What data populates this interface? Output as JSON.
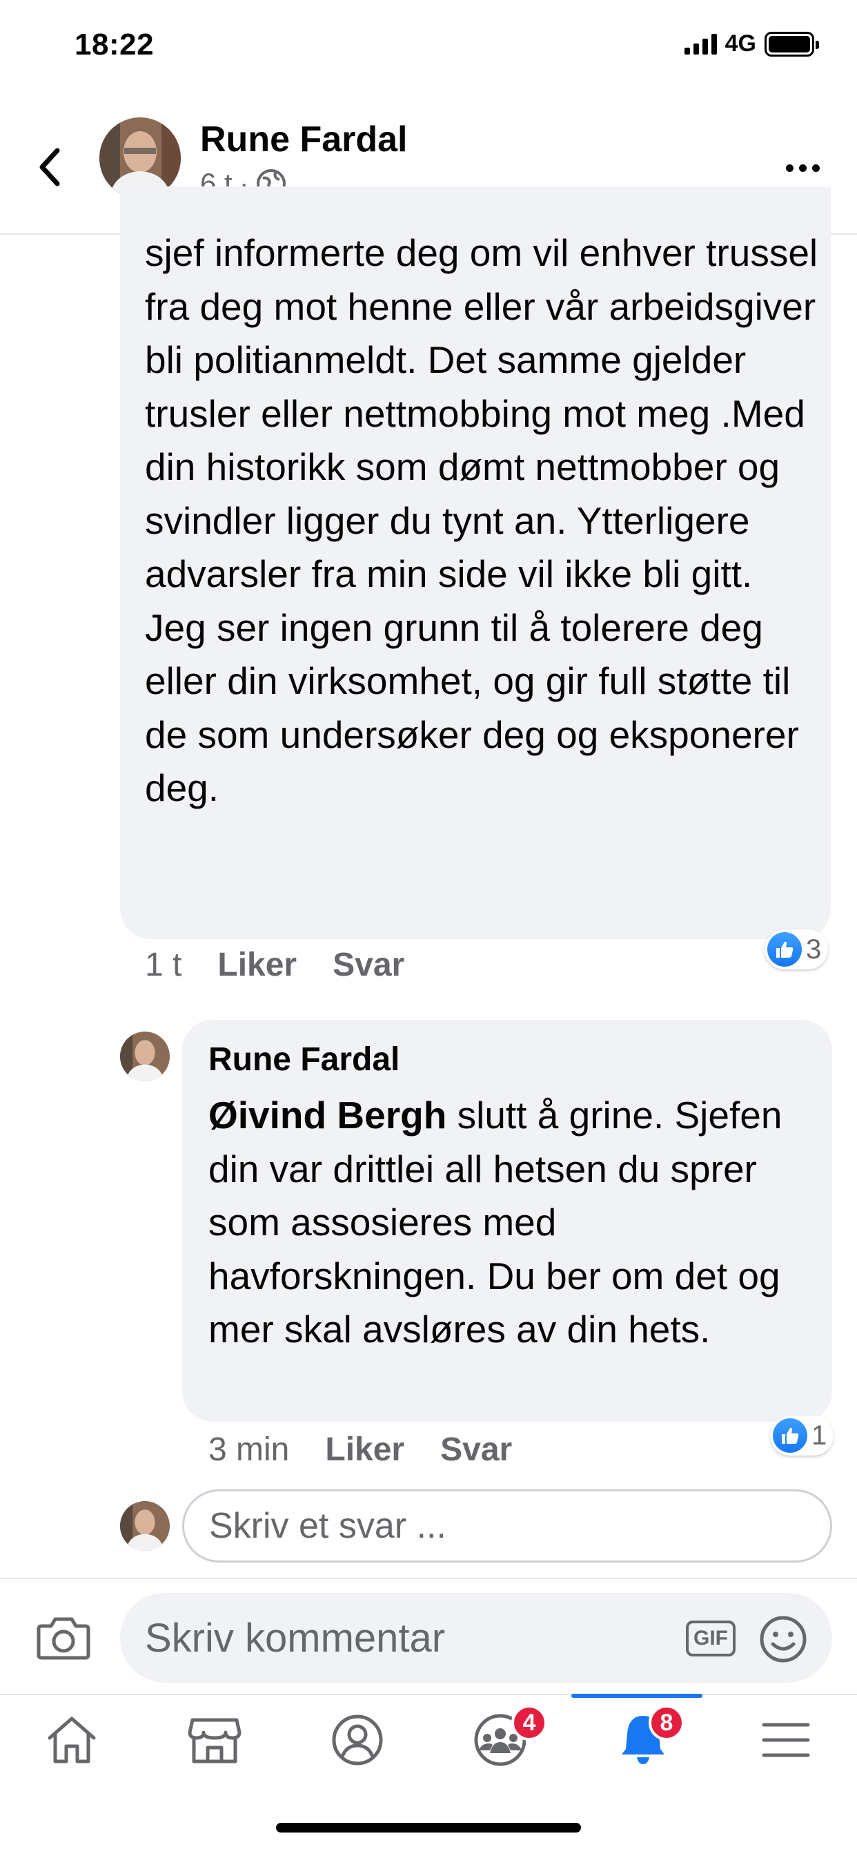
{
  "status_bar": {
    "time": "18:22",
    "network": "4G"
  },
  "header": {
    "name": "Rune Fardal",
    "time": "6 t",
    "separator": "·"
  },
  "comment": {
    "text": "sjef informerte deg om vil enhver trussel fra deg mot henne eller vår arbeidsgiver bli politianmeldt. Det samme gjelder trusler eller nettmobbing mot meg .Med din historikk som dømt nettmobber og svindler ligger du tynt an. Ytterligere advarsler fra min side vil ikke bli gitt. Jeg ser ingen grunn til å tolerere deg eller din virksomhet, og gir full støtte til de som undersøker deg og eksponerer deg.",
    "time": "1 t",
    "like_label": "Liker",
    "reply_label": "Svar",
    "reaction_count": "3"
  },
  "reply": {
    "author": "Rune Fardal",
    "mention": "Øivind Bergh",
    "text": " slutt å grine. Sjefen din var drittlei all hetsen du sprer som assosieres med havforskningen. Du ber om det og mer skal avsløres av din hets.",
    "time": "3 min",
    "like_label": "Liker",
    "reply_label": "Svar",
    "reaction_count": "1"
  },
  "reply_input": {
    "placeholder": "Skriv et svar ..."
  },
  "compose": {
    "placeholder": "Skriv kommentar",
    "gif_label": "GIF"
  },
  "tabbar": {
    "tabs": [
      {
        "name": "home",
        "icon": "home-icon"
      },
      {
        "name": "marketplace",
        "icon": "marketplace-icon"
      },
      {
        "name": "profile",
        "icon": "profile-icon"
      },
      {
        "name": "groups",
        "icon": "groups-icon",
        "badge": "4"
      },
      {
        "name": "notifications",
        "icon": "bell-icon",
        "badge": "8",
        "active": true
      },
      {
        "name": "menu",
        "icon": "menu-icon"
      }
    ]
  },
  "colors": {
    "accent": "#1877f2",
    "badge": "#e41e3f",
    "bubble": "#f0f2f5",
    "secondary_text": "#65676b"
  }
}
